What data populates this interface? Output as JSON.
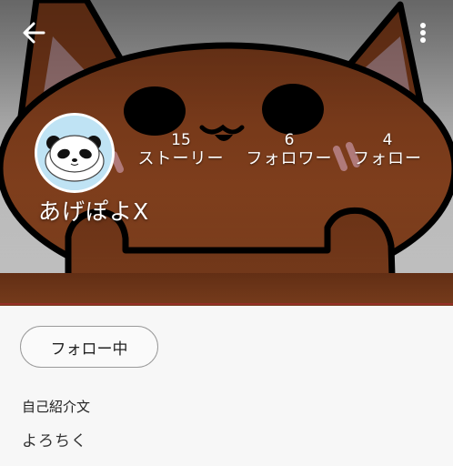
{
  "header": {
    "back_icon": "arrow-left-icon",
    "menu_icon": "more-vert-icon",
    "cover_colors": {
      "fur": "#7a3a1a",
      "sky_top": "#8c8c8c",
      "sky_bottom": "#d8d8d8"
    }
  },
  "profile": {
    "username": "あげぽよX",
    "avatar_icon": "panda-avatar-icon"
  },
  "stats": [
    {
      "value": "15",
      "label": "ストーリー"
    },
    {
      "value": "6",
      "label": "フォロワー"
    },
    {
      "value": "4",
      "label": "フォロー"
    }
  ],
  "actions": {
    "follow_label": "フォロー中"
  },
  "bio": {
    "heading": "自己紹介文",
    "text": "よろちく"
  }
}
